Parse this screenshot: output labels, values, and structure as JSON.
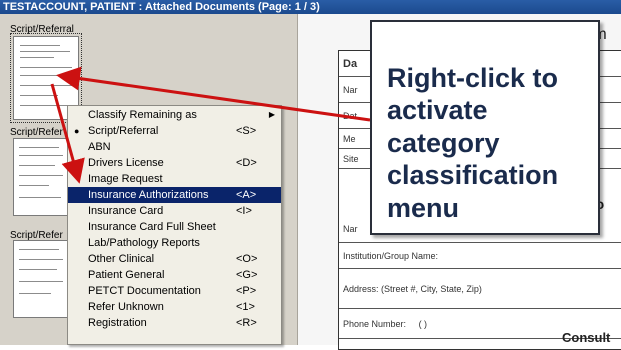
{
  "window": {
    "title": "TESTACCOUNT, PATIENT : Attached Documents (Page: 1 / 3)"
  },
  "thumbnails": [
    {
      "label": "Script/Referral",
      "selected": true
    },
    {
      "label": "Script/Refer",
      "selected": false
    },
    {
      "label": "Script/Refer",
      "selected": false
    }
  ],
  "context_menu": {
    "items": [
      {
        "label": "Classify Remaining as",
        "shortcut": "",
        "submenu_arrow": "▶",
        "bullet": "",
        "highlighted": false
      },
      {
        "label": "Script/Referral",
        "shortcut": "<S>",
        "submenu_arrow": "",
        "bullet": "●",
        "highlighted": false
      },
      {
        "label": "ABN",
        "shortcut": "",
        "submenu_arrow": "",
        "bullet": "",
        "highlighted": false
      },
      {
        "label": "Drivers License",
        "shortcut": "<D>",
        "submenu_arrow": "",
        "bullet": "",
        "highlighted": false
      },
      {
        "label": "Image Request",
        "shortcut": "",
        "submenu_arrow": "",
        "bullet": "",
        "highlighted": false
      },
      {
        "label": "Insurance Authorizations",
        "shortcut": "<A>",
        "submenu_arrow": "",
        "bullet": "",
        "highlighted": true
      },
      {
        "label": "Insurance Card",
        "shortcut": "<I>",
        "submenu_arrow": "",
        "bullet": "",
        "highlighted": false
      },
      {
        "label": "Insurance Card Full Sheet",
        "shortcut": "",
        "submenu_arrow": "",
        "bullet": "",
        "highlighted": false
      },
      {
        "label": "Lab/Pathology Reports",
        "shortcut": "",
        "submenu_arrow": "",
        "bullet": "",
        "highlighted": false
      },
      {
        "label": "Other Clinical",
        "shortcut": "<O>",
        "submenu_arrow": "",
        "bullet": "",
        "highlighted": false
      },
      {
        "label": "Patient General",
        "shortcut": "<G>",
        "submenu_arrow": "",
        "bullet": "",
        "highlighted": false
      },
      {
        "label": "PETCT Documentation",
        "shortcut": "<P>",
        "submenu_arrow": "",
        "bullet": "",
        "highlighted": false
      },
      {
        "label": "Refer Unknown",
        "shortcut": "<1>",
        "submenu_arrow": "",
        "bullet": "",
        "highlighted": false
      },
      {
        "label": "Registration",
        "shortcut": "<R>",
        "submenu_arrow": "",
        "bullet": "",
        "highlighted": false
      }
    ]
  },
  "document": {
    "header_fragment": "rm",
    "rows": [
      "Da",
      "Nar",
      "Dat",
      "Me",
      "Site"
    ],
    "name_label": "Nar",
    "fragment_right": "y o",
    "institution_label": "Institution/Group Name:",
    "address_label": "Address: (Street #, City, State, Zip)",
    "phone_label": "Phone Number:",
    "phone_paren": "(        )",
    "consult_label": "Consult"
  },
  "callout": {
    "text": "Right-click to activate category classification menu"
  },
  "colors": {
    "arrow": "#cc1111",
    "titlebar": "#1b4a8e",
    "menu_highlight": "#0a246a",
    "callout_text": "#1a2b4c"
  }
}
